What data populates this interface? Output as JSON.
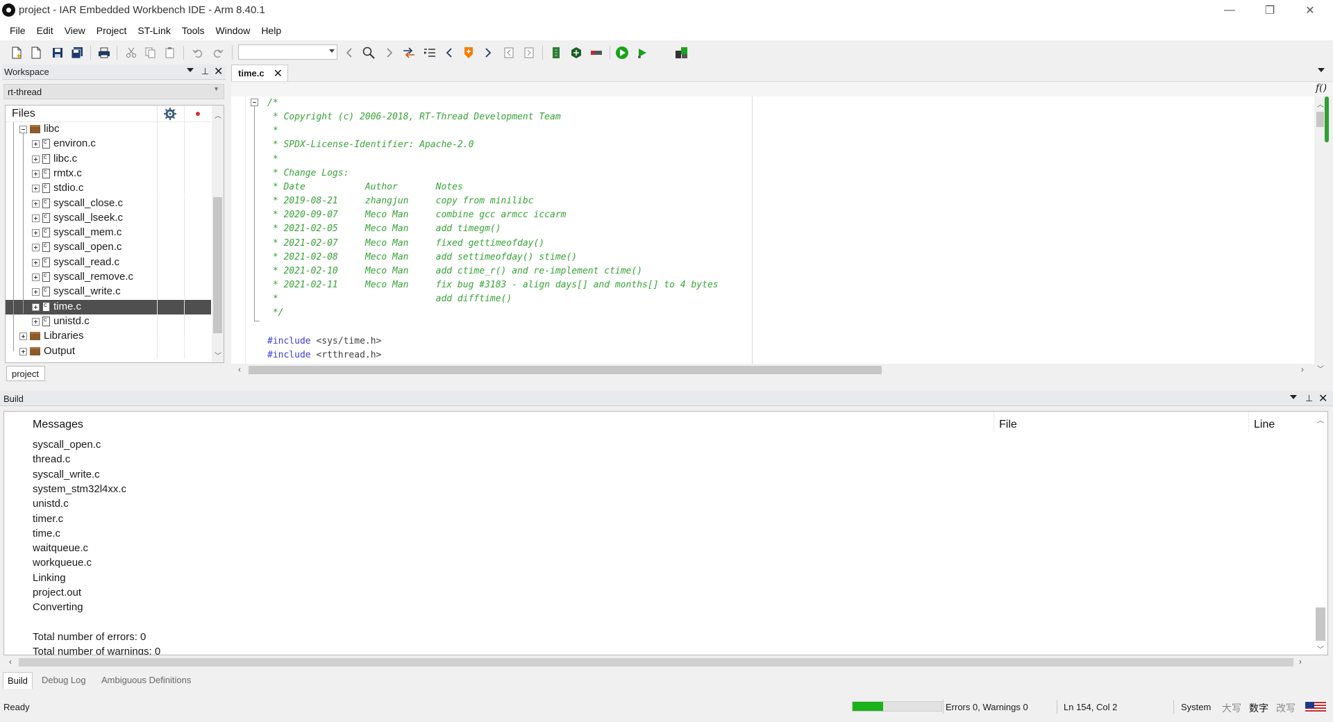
{
  "window": {
    "title": "project - IAR Embedded Workbench IDE - Arm 8.40.1",
    "controls": {
      "minimize": "—",
      "restore": "❐",
      "close": "✕"
    }
  },
  "menu": [
    "File",
    "Edit",
    "View",
    "Project",
    "ST-Link",
    "Tools",
    "Window",
    "Help"
  ],
  "toolbar": {
    "find_combo_value": "",
    "icons": [
      "new-file-icon",
      "open-icon",
      "save-icon",
      "save-all-icon",
      "print-icon",
      "cut-icon",
      "copy-icon",
      "paste-icon",
      "undo-icon",
      "redo-icon",
      "find-icon",
      "navigate-back-icon",
      "navigate-forward-icon",
      "toggle-bookmark-icon",
      "next-bookmark-icon",
      "previous-bookmark-icon",
      "make-icon",
      "compile-icon",
      "stop-build-icon",
      "download-debug-icon",
      "debug-without-download-icon",
      "breakpoint-icon"
    ]
  },
  "workspace": {
    "title": "Workspace",
    "config": "rt-thread",
    "files_header": "Files",
    "tree": [
      {
        "label": "libc",
        "kind": "folder",
        "level": 1,
        "expanded": true
      },
      {
        "label": "environ.c",
        "kind": "file",
        "level": 2
      },
      {
        "label": "libc.c",
        "kind": "file",
        "level": 2
      },
      {
        "label": "rmtx.c",
        "kind": "file",
        "level": 2
      },
      {
        "label": "stdio.c",
        "kind": "file",
        "level": 2
      },
      {
        "label": "syscall_close.c",
        "kind": "file",
        "level": 2
      },
      {
        "label": "syscall_lseek.c",
        "kind": "file",
        "level": 2
      },
      {
        "label": "syscall_mem.c",
        "kind": "file",
        "level": 2
      },
      {
        "label": "syscall_open.c",
        "kind": "file",
        "level": 2
      },
      {
        "label": "syscall_read.c",
        "kind": "file",
        "level": 2
      },
      {
        "label": "syscall_remove.c",
        "kind": "file",
        "level": 2
      },
      {
        "label": "syscall_write.c",
        "kind": "file",
        "level": 2
      },
      {
        "label": "time.c",
        "kind": "file",
        "level": 2,
        "selected": true
      },
      {
        "label": "unistd.c",
        "kind": "file",
        "level": 2
      },
      {
        "label": "Libraries",
        "kind": "folder",
        "level": 1
      },
      {
        "label": "Output",
        "kind": "folder",
        "level": 1
      }
    ],
    "tab": "project"
  },
  "editor": {
    "tab": "time.c",
    "function_nav": "f()",
    "code_lines": [
      "/*",
      " * Copyright (c) 2006-2018, RT-Thread Development Team",
      " *",
      " * SPDX-License-Identifier: Apache-2.0",
      " *",
      " * Change Logs:",
      " * Date           Author       Notes",
      " * 2019-08-21     zhangjun     copy from minilibc",
      " * 2020-09-07     Meco Man     combine gcc armcc iccarm",
      " * 2021-02-05     Meco Man     add timegm()",
      " * 2021-02-07     Meco Man     fixed gettimeofday()",
      " * 2021-02-08     Meco Man     add settimeofday() stime()",
      " * 2021-02-10     Meco Man     add ctime_r() and re-implement ctime()",
      " * 2021-02-11     Meco Man     fix bug #3183 - align days[] and months[] to 4 bytes",
      " *                             add difftime()",
      " */",
      ""
    ],
    "include_lines": [
      {
        "directive": "#include",
        "target": " <sys/time.h>"
      },
      {
        "directive": "#include",
        "target": " <rtthread.h>"
      }
    ]
  },
  "build": {
    "title": "Build",
    "columns": {
      "messages": "Messages",
      "file": "File",
      "line": "Line"
    },
    "messages": [
      "syscall_open.c",
      "thread.c",
      "syscall_write.c",
      "system_stm32l4xx.c",
      "unistd.c",
      "timer.c",
      "time.c",
      "waitqueue.c",
      "workqueue.c",
      "Linking",
      "project.out",
      "Converting",
      "",
      "Total number of errors: 0",
      "Total number of warnings: 0"
    ],
    "tabs": [
      "Build",
      "Debug Log",
      "Ambiguous Definitions"
    ]
  },
  "status": {
    "ready": "Ready",
    "progress": 0.34,
    "errors_warnings": "Errors 0, Warnings 0",
    "position": "Ln 154, Col 2",
    "system": "System",
    "caps": "大写",
    "num": "数字",
    "ovr": "改写",
    "progress_color": "#1ab21a"
  },
  "colors": {
    "comment": "#36a336",
    "keyword": "#3d3dd6",
    "selection": "#4f4f4f"
  }
}
